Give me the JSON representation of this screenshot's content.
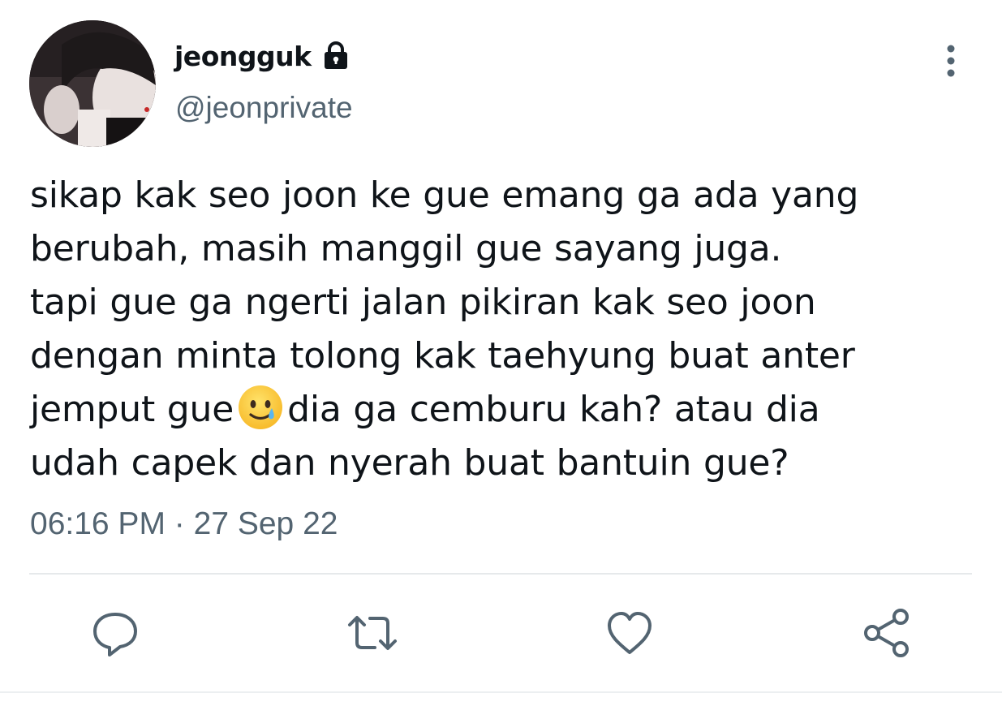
{
  "author": {
    "display_name": "jeongguk",
    "handle": "@jeonprivate",
    "protected_icon": "lock-icon",
    "avatar_icon": "profile-photo"
  },
  "tweet": {
    "lines": [
      "sikap kak seo joon ke gue emang ga ada yang",
      "berubah, masih manggil gue sayang juga.",
      "tapi gue ga ngerti jalan pikiran kak seo joon",
      "dengan minta tolong kak taehyung buat anter",
      "jemput gue",
      "dia ga cemburu kah? atau dia",
      "udah capek dan nyerah buat bantuin gue?"
    ],
    "emoji": "smiling-face-with-tear-emoji",
    "time": "06:16 PM",
    "separator": "·",
    "date": "27 Sep 22"
  },
  "actions": [
    {
      "name": "reply",
      "icon": "reply-icon"
    },
    {
      "name": "retweet",
      "icon": "retweet-icon"
    },
    {
      "name": "like",
      "icon": "heart-icon"
    },
    {
      "name": "share",
      "icon": "share-icon"
    }
  ],
  "colors": {
    "text_primary": "#0f1419",
    "text_secondary": "#536471",
    "divider": "#e6e9eb"
  }
}
